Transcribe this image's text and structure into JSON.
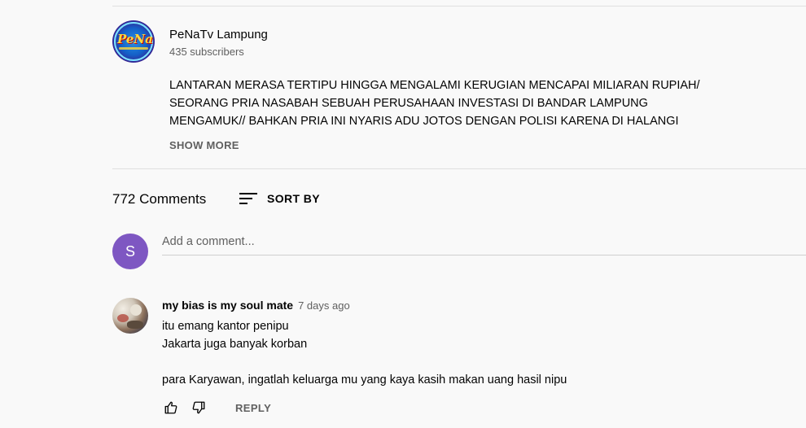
{
  "channel": {
    "name": "PeNaTv Lampung",
    "subscribers": "435 subscribers",
    "avatar_text": "PeNa"
  },
  "description": {
    "lines": [
      "LANTARAN MERASA TERTIPU HINGGA MENGALAMI KERUGIAN MENCAPAI MILIARAN RUPIAH/",
      "SEORANG PRIA NASABAH SEBUAH PERUSAHAAN INVESTASI DI BANDAR LAMPUNG",
      "MENGAMUK// BAHKAN PRIA INI NYARIS ADU JOTOS DENGAN POLISI KARENA DI HALANGI"
    ],
    "show_more": "SHOW MORE"
  },
  "comments_header": {
    "count": "772 Comments",
    "sort_label": "SORT BY"
  },
  "add_comment": {
    "avatar_letter": "S",
    "placeholder": "Add a comment...",
    "avatar_color": "#7e57c2"
  },
  "comment": {
    "author": "my bias is my soul mate",
    "time": "7 days ago",
    "lines": [
      "itu emang kantor penipu",
      "Jakarta juga banyak korban",
      "",
      "para Karyawan, ingatlah keluarga mu yang kaya kasih makan uang hasil nipu"
    ],
    "reply_label": "REPLY"
  },
  "icons": [
    "sort-icon",
    "thumb-up-icon",
    "thumb-down-icon"
  ]
}
